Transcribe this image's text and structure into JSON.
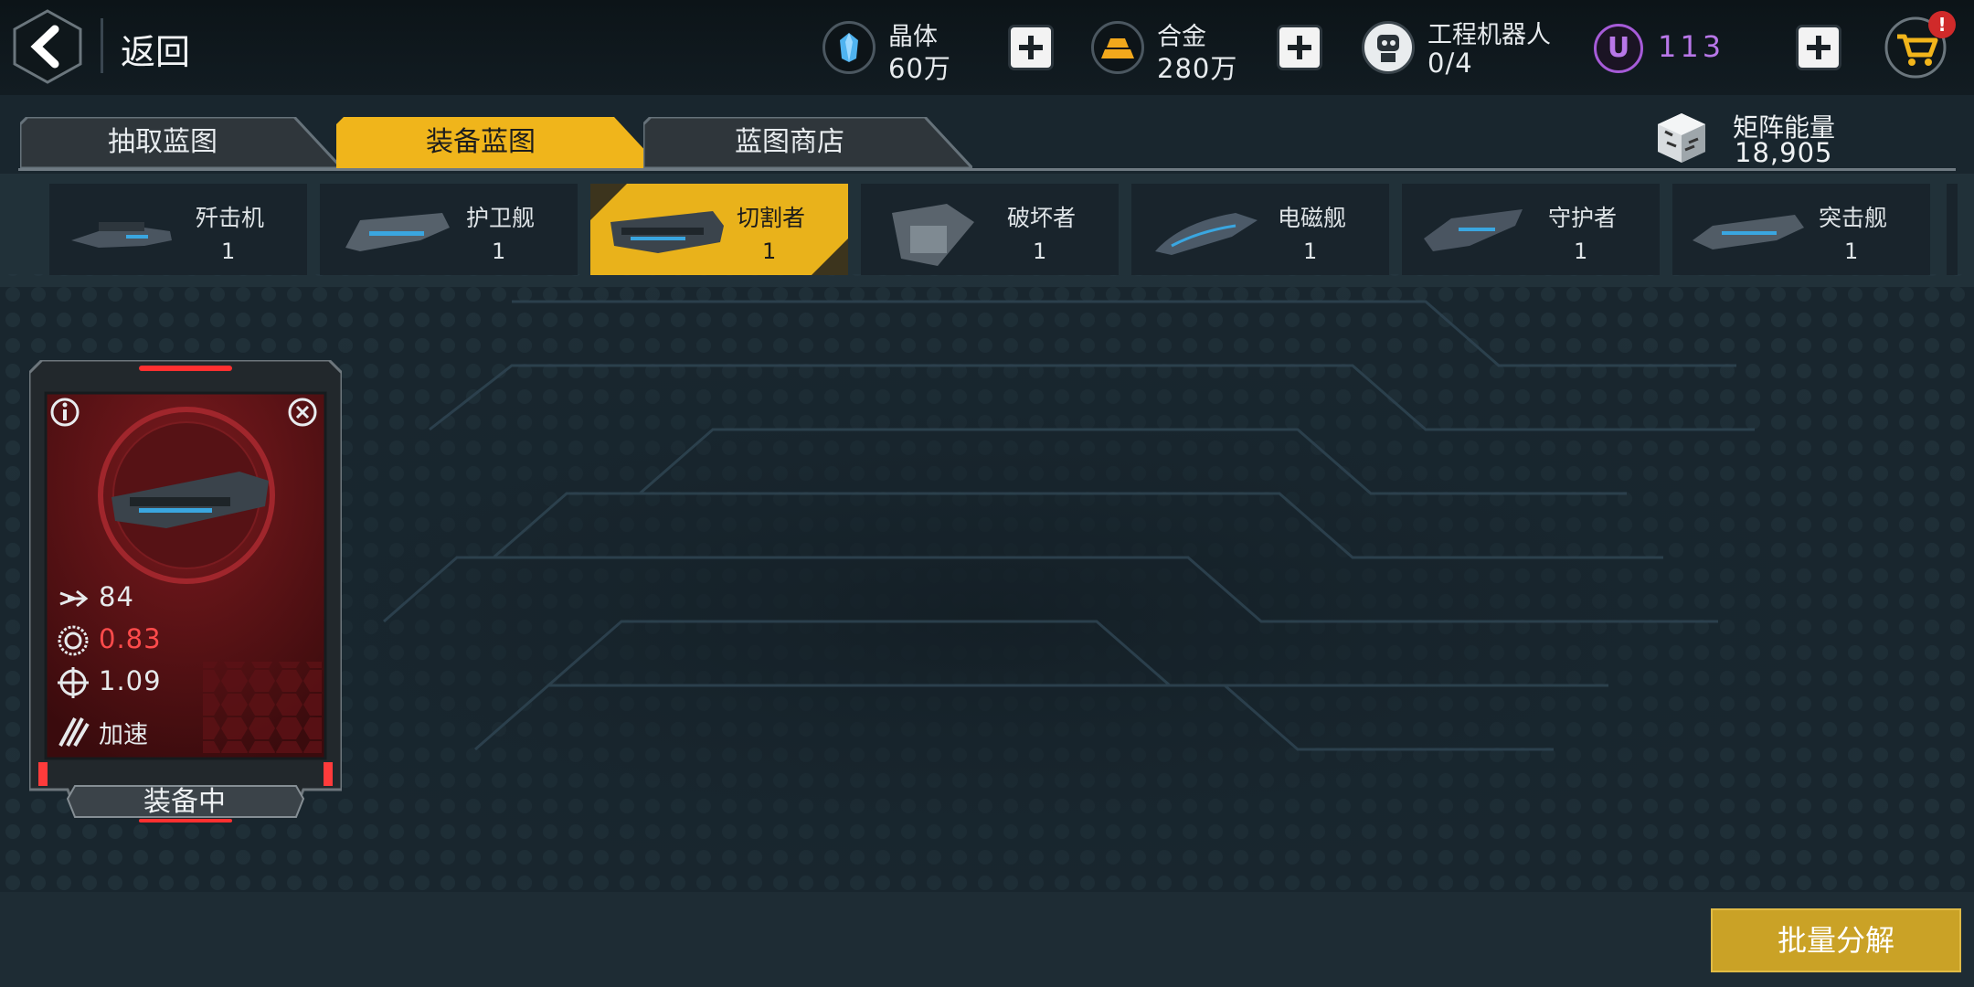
{
  "header": {
    "back_label": "返回",
    "resources": [
      {
        "label": "晶体",
        "value": "60万",
        "icon": "crystal-icon"
      },
      {
        "label": "合金",
        "value": "280万",
        "icon": "alloy-icon"
      },
      {
        "label": "工程机器人",
        "value": "0/4",
        "icon": "robot-icon"
      }
    ],
    "currency": {
      "icon_letter": "U",
      "value": "113"
    },
    "cart_badge": "!"
  },
  "tabs": [
    {
      "label": "抽取蓝图",
      "active": false
    },
    {
      "label": "装备蓝图",
      "active": true
    },
    {
      "label": "蓝图商店",
      "active": false
    }
  ],
  "matrix_energy": {
    "label": "矩阵能量",
    "value": "18,905"
  },
  "ships": [
    {
      "name": "歼击机",
      "count": "1",
      "selected": false
    },
    {
      "name": "护卫舰",
      "count": "1",
      "selected": false
    },
    {
      "name": "切割者",
      "count": "1",
      "selected": true
    },
    {
      "name": "破坏者",
      "count": "1",
      "selected": false
    },
    {
      "name": "电磁舰",
      "count": "1",
      "selected": false
    },
    {
      "name": "守护者",
      "count": "1",
      "selected": false
    },
    {
      "name": "突击舰",
      "count": "1",
      "selected": false
    }
  ],
  "equip_card": {
    "stats": [
      {
        "icon": "speed-arrow-icon",
        "value": "84"
      },
      {
        "icon": "fire-rate-icon",
        "value": "0.83"
      },
      {
        "icon": "crosshair-icon",
        "value": "1.09"
      },
      {
        "icon": "boost-icon",
        "value": "加速"
      }
    ],
    "status_label": "装备中"
  },
  "decompose_label": "批量分解",
  "colors": {
    "accent_gold": "#e9b21b",
    "card_red": "#6a1418",
    "currency_purple": "#a65bd8"
  }
}
